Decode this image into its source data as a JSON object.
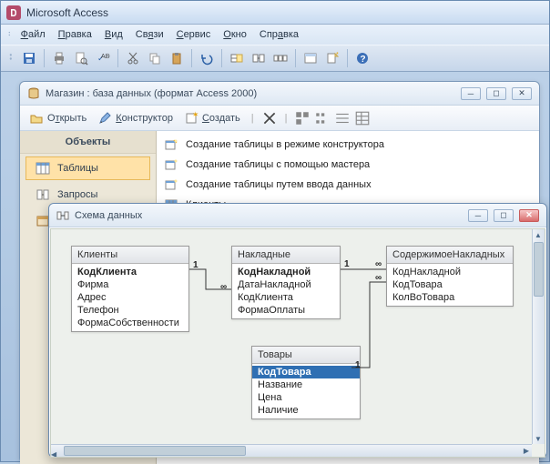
{
  "app": {
    "title": "Microsoft Access"
  },
  "menu": {
    "file": "Файл",
    "edit": "Правка",
    "view": "Вид",
    "links": "Связи",
    "service": "Сервис",
    "window": "Окно",
    "help": "Справка"
  },
  "dbwin": {
    "title": "Магазин : база данных (формат Access 2000)",
    "toolbar": {
      "open": "Открыть",
      "design": "Конструктор",
      "create": "Создать"
    },
    "sidebar": {
      "header": "Объекты",
      "items": [
        {
          "label": "Таблицы"
        },
        {
          "label": "Запросы"
        }
      ]
    },
    "list": [
      "Создание таблицы в режиме конструктора",
      "Создание таблицы с помощью мастера",
      "Создание таблицы путем ввода данных",
      "Клиенты"
    ]
  },
  "schemawin": {
    "title": "Схема данных",
    "tables": {
      "clients": {
        "name": "Клиенты",
        "fields": [
          "КодКлиента",
          "Фиpма",
          "Адрес",
          "Телефон",
          "ФормаСобственности"
        ],
        "pk": 0
      },
      "invoices": {
        "name": "Накладные",
        "fields": [
          "КодНакладной",
          "ДатаНакладной",
          "КодКлиента",
          "ФормаОплаты"
        ],
        "pk": 0
      },
      "contents": {
        "name": "СодержимоеНакладных",
        "fields": [
          "КодНакладной",
          "КодТовара",
          "КолВоТовара"
        ],
        "pk": -1
      },
      "goods": {
        "name": "Товары",
        "fields": [
          "КодТовара",
          "Название",
          "Цена",
          "Наличие"
        ],
        "pk": 0,
        "selected": 0
      }
    },
    "relation_labels": {
      "one": "1",
      "many": "∞"
    }
  }
}
